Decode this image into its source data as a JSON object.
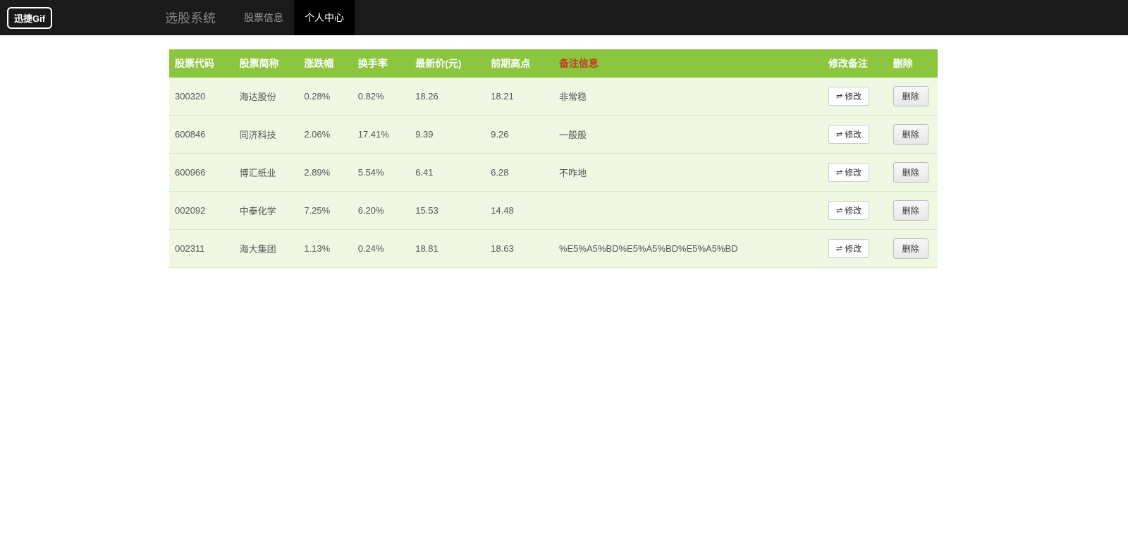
{
  "navbar": {
    "logo": "迅捷Gif",
    "brand": "选股系统",
    "items": [
      {
        "label": "股票信息",
        "active": false
      },
      {
        "label": "个人中心",
        "active": true
      }
    ]
  },
  "table": {
    "headers": {
      "code": "股票代码",
      "name": "股票简称",
      "change": "涨跌幅",
      "turnover": "换手率",
      "price": "最新价(元)",
      "high": "前期高点",
      "remark": "备注信息",
      "edit": "修改备注",
      "delete": "删除"
    },
    "rows": [
      {
        "code": "300320",
        "name": "海达股份",
        "change": "0.28%",
        "turnover": "0.82%",
        "price": "18.26",
        "high": "18.21",
        "remark": "非常稳"
      },
      {
        "code": "600846",
        "name": "同济科技",
        "change": "2.06%",
        "turnover": "17.41%",
        "price": "9.39",
        "high": "9.26",
        "remark": "一般般"
      },
      {
        "code": "600966",
        "name": "博汇纸业",
        "change": "2.89%",
        "turnover": "5.54%",
        "price": "6.41",
        "high": "6.28",
        "remark": "不咋地"
      },
      {
        "code": "002092",
        "name": "中泰化学",
        "change": "7.25%",
        "turnover": "6.20%",
        "price": "15.53",
        "high": "14.48",
        "remark": ""
      },
      {
        "code": "002311",
        "name": "海大集团",
        "change": "1.13%",
        "turnover": "0.24%",
        "price": "18.81",
        "high": "18.63",
        "remark": "%E5%A5%BD%E5%A5%BD%E5%A5%BD"
      }
    ],
    "buttons": {
      "edit": "修改",
      "delete": "删除"
    }
  }
}
